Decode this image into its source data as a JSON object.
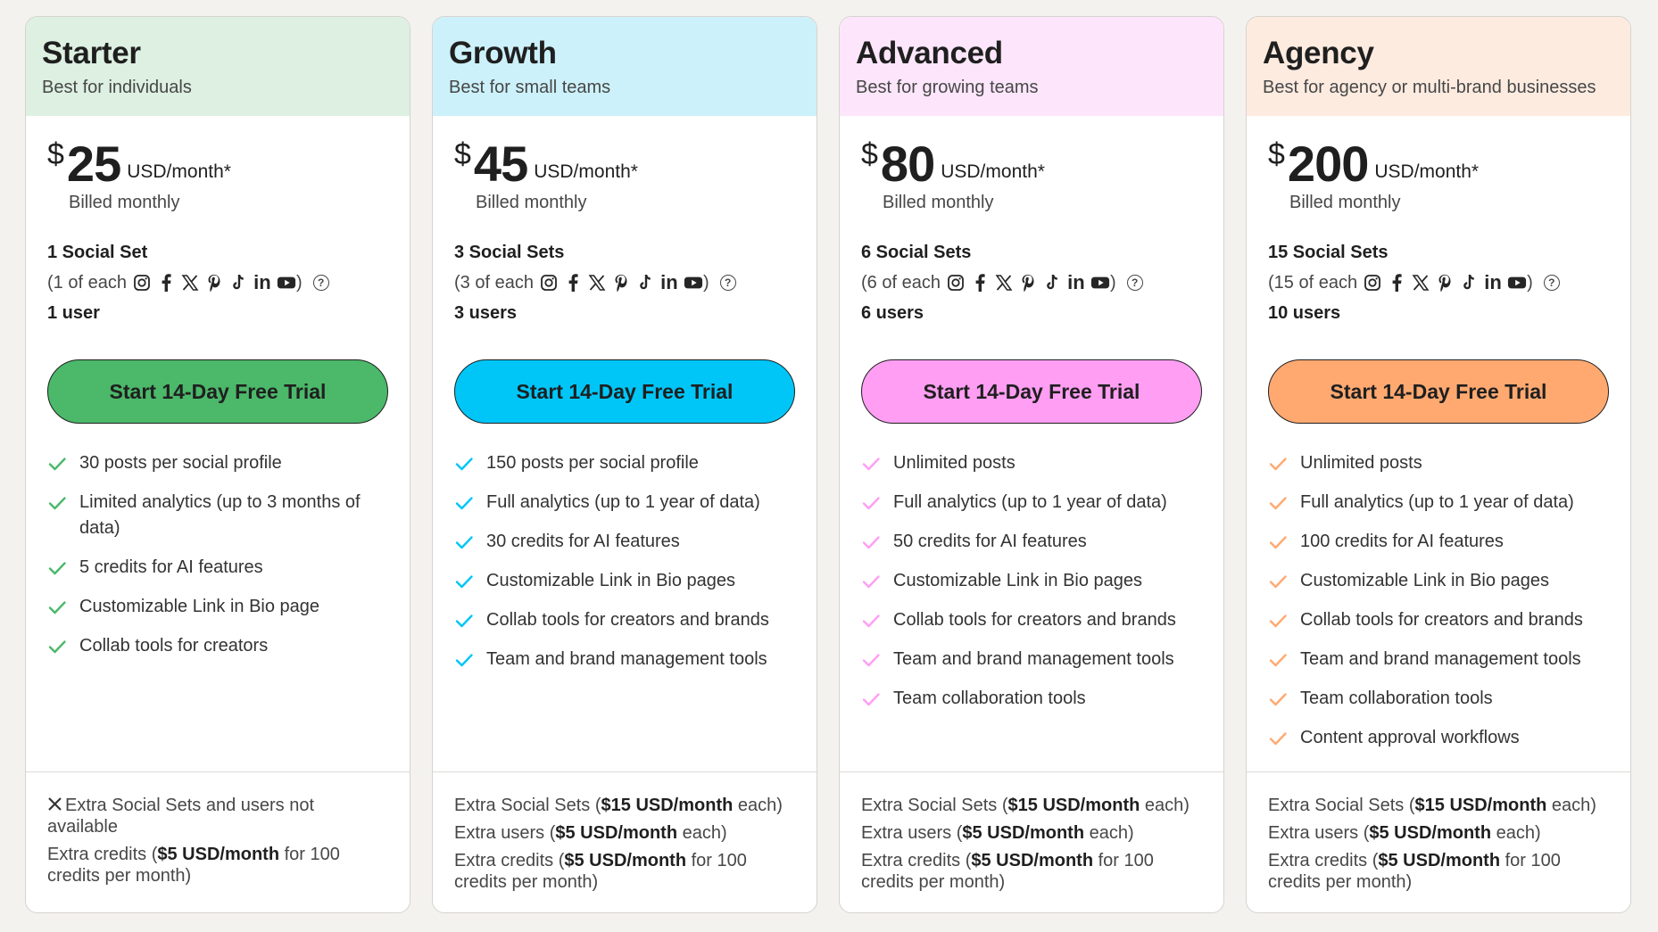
{
  "plans": [
    {
      "name": "Starter",
      "tagline": "Best for individuals",
      "currency": "$",
      "price": "25",
      "period": "USD/month*",
      "billing": "Billed monthly",
      "social_sets": "1 Social Set",
      "each_prefix": "(1 of each",
      "users": "1 user",
      "cta": "Start 14-Day Free Trial",
      "header_bg": "#ddf0e2",
      "accent": "#4bb86a",
      "features": [
        "30 posts per social profile",
        "Limited analytics (up to 3 months of data)",
        "5 credits for AI features",
        "Customizable Link in Bio page",
        "Collab tools for creators"
      ],
      "extras": {
        "not_available": "Extra Social Sets and users not available",
        "sets_prefix": "",
        "sets_price": "",
        "sets_suffix": "",
        "users_prefix": "",
        "users_price": "",
        "users_suffix": "",
        "credits_prefix": "Extra credits (",
        "credits_price": "$5 USD/month",
        "credits_suffix": " for 100 credits per month)"
      }
    },
    {
      "name": "Growth",
      "tagline": "Best for small teams",
      "currency": "$",
      "price": "45",
      "period": "USD/month*",
      "billing": "Billed monthly",
      "social_sets": "3 Social Sets",
      "each_prefix": "(3 of each",
      "users": "3 users",
      "cta": "Start 14-Day Free Trial",
      "header_bg": "#ccf1fb",
      "accent": "#00c6f8",
      "features": [
        "150 posts per social profile",
        "Full analytics (up to 1 year of data)",
        "30 credits for AI features",
        "Customizable Link in Bio pages",
        "Collab tools for creators and brands",
        "Team and brand management tools"
      ],
      "extras": {
        "not_available": "",
        "sets_prefix": "Extra Social Sets (",
        "sets_price": "$15 USD/month",
        "sets_suffix": " each)",
        "users_prefix": "Extra users (",
        "users_price": "$5 USD/month",
        "users_suffix": " each)",
        "credits_prefix": "Extra credits (",
        "credits_price": "$5 USD/month",
        "credits_suffix": " for 100 credits per month)"
      }
    },
    {
      "name": "Advanced",
      "tagline": "Best for growing teams",
      "currency": "$",
      "price": "80",
      "period": "USD/month*",
      "billing": "Billed monthly",
      "social_sets": "6 Social Sets",
      "each_prefix": "(6 of each",
      "users": "6 users",
      "cta": "Start 14-Day Free Trial",
      "header_bg": "#fde6fb",
      "accent": "#ff9ef3",
      "features": [
        "Unlimited posts",
        "Full analytics (up to 1 year of data)",
        "50 credits for AI features",
        "Customizable Link in Bio pages",
        "Collab tools for creators and brands",
        "Team and brand management tools",
        "Team collaboration tools"
      ],
      "extras": {
        "not_available": "",
        "sets_prefix": "Extra Social Sets (",
        "sets_price": "$15 USD/month",
        "sets_suffix": " each)",
        "users_prefix": "Extra users (",
        "users_price": "$5 USD/month",
        "users_suffix": " each)",
        "credits_prefix": "Extra credits (",
        "credits_price": "$5 USD/month",
        "credits_suffix": " for 100 credits per month)"
      }
    },
    {
      "name": "Agency",
      "tagline": "Best for agency or multi-brand businesses",
      "currency": "$",
      "price": "200",
      "period": "USD/month*",
      "billing": "Billed monthly",
      "social_sets": "15 Social Sets",
      "each_prefix": "(15 of each",
      "users": "10 users",
      "cta": "Start 14-Day Free Trial",
      "header_bg": "#fdebe0",
      "accent": "#ffa970",
      "features": [
        "Unlimited posts",
        "Full analytics (up to 1 year of data)",
        "100 credits for AI features",
        "Customizable Link in Bio pages",
        "Collab tools for creators and brands",
        "Team and brand management tools",
        "Team collaboration tools",
        "Content approval workflows"
      ],
      "extras": {
        "not_available": "",
        "sets_prefix": "Extra Social Sets (",
        "sets_price": "$15 USD/month",
        "sets_suffix": " each)",
        "users_prefix": "Extra users (",
        "users_price": "$5 USD/month",
        "users_suffix": " each)",
        "credits_prefix": "Extra credits (",
        "credits_price": "$5 USD/month",
        "credits_suffix": " for 100 credits per month)"
      }
    }
  ],
  "social_icons": [
    "instagram-icon",
    "facebook-icon",
    "x-icon",
    "pinterest-icon",
    "tiktok-icon",
    "linkedin-icon",
    "youtube-icon"
  ],
  "help_glyph": "?",
  "check_stroke_colors_note_free": true
}
